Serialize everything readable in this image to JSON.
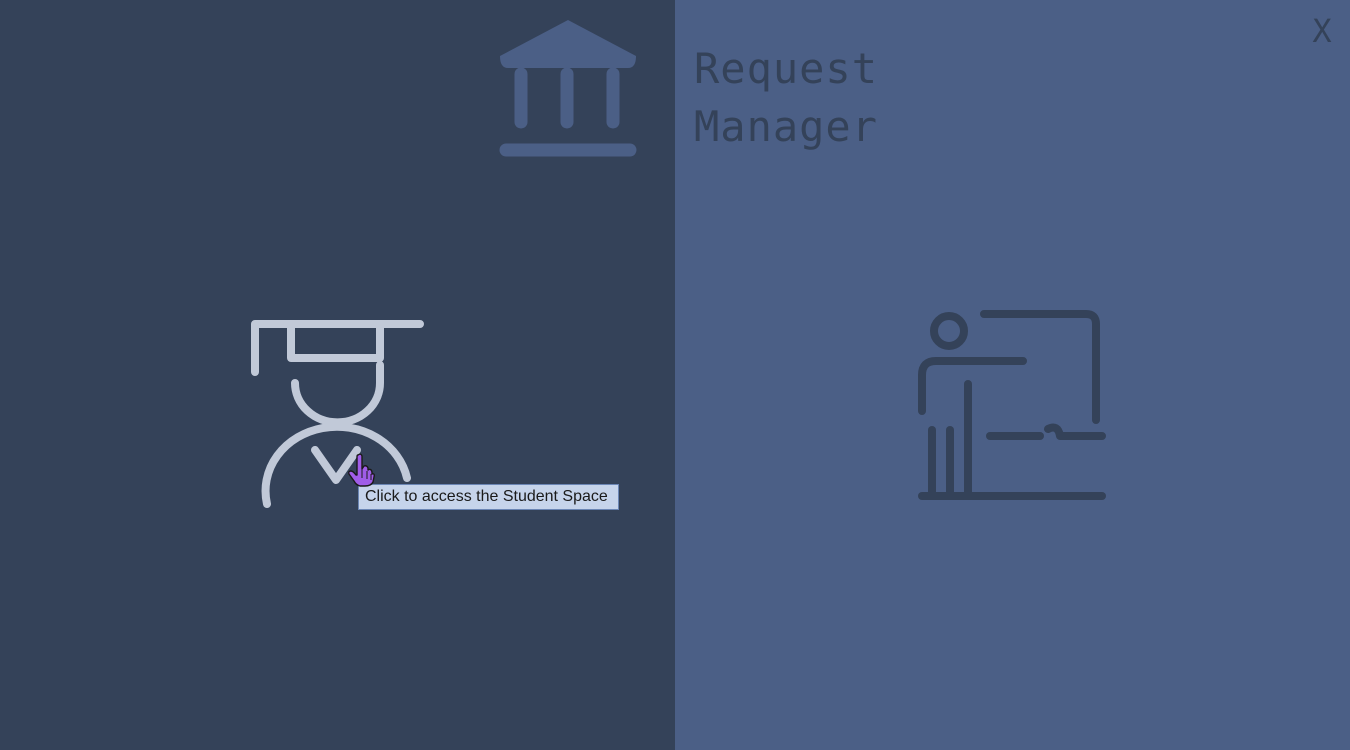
{
  "header": {
    "title_line1": "Request",
    "title_line2": "Manager",
    "logo_icon": "institution-icon"
  },
  "window": {
    "close_label": "X"
  },
  "spaces": {
    "student": {
      "icon": "student-graduate-icon",
      "tooltip": "Click to access the Student Space"
    },
    "teacher": {
      "icon": "teacher-board-icon"
    }
  },
  "colors": {
    "left_panel": "#344259",
    "right_panel": "#4b5f86",
    "student_icon": "#c1c9d8",
    "institution_icon": "#4b5f86",
    "teacher_icon": "#344259",
    "title_text": "#344259",
    "tooltip_bg": "#c6d4eb",
    "cursor": "#a05de8"
  }
}
